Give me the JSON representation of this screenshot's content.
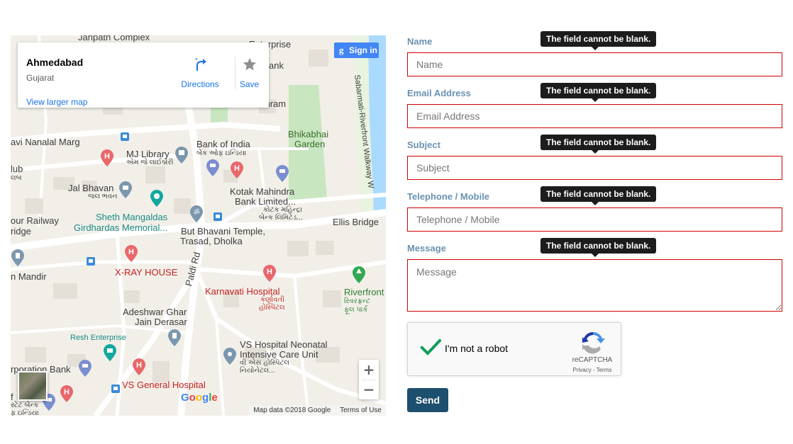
{
  "map": {
    "place_name": "Ahmedabad",
    "place_region": "Gujarat",
    "directions_label": "Directions",
    "save_label": "Save",
    "larger_map_label": "View larger map",
    "signin_label": "Sign in",
    "zoom_in_label": "+",
    "zoom_out_label": "−",
    "google_logo": [
      "G",
      "o",
      "o",
      "g",
      "l",
      "e"
    ],
    "google_colors": [
      "#4285f4",
      "#ea4335",
      "#fbbc05",
      "#4285f4",
      "#34a853",
      "#ea4335"
    ],
    "footer": {
      "map_data": "Map data ©2018 Google",
      "terms": "Terms of Use"
    },
    "labels": {
      "janpath": "Janpath Complex",
      "enterprise": "Enterprise",
      "bank_top": "ank",
      "ashram": "shram",
      "nanalal": "avi Nanalal Marg",
      "mj_library": "MJ Library",
      "mj_library_guj": "એમ જે લાઈબ્રેરી",
      "bank_of_india": "Bank of India",
      "bank_of_india_guj": "બેંક ઓફ ઇન્ડિયા",
      "bhikabhai": "Bhikabhai",
      "garden": "Garden",
      "riverfront_walkway": "Sabarmati-Riverfront Walkway W",
      "club": "lub",
      "club_guj": "લબ",
      "jal_bhavan": "Jal Bhavan",
      "jal_bhavan_guj": "જલ ભવન",
      "kotak_1": "Kotak Mahindra",
      "kotak_2": "Bank Limited...",
      "kotak_guj_1": "કોટક મહિન્દ્રા",
      "kotak_guj_2": "બેન્ક લિમિટેડ...",
      "railway_1": "our Railway",
      "railway_2": "ridge",
      "sheth_1": "Sheth Mangaldas",
      "sheth_2": "Girdhardas Memorial...",
      "ellis_bridge": "Ellis Bridge",
      "bhavani_1": "But Bhavani Temple,",
      "bhavani_2": "Trasad, Dholka",
      "paldi_rd": "Paldi Rd",
      "mandir": "n Mandir",
      "xray": "X-RAY HOUSE",
      "karnavati": "Karnavati Hospital",
      "karnavati_guj_1": "કર્ણાવતી",
      "karnavati_guj_2": "હોસ્પિટલ",
      "riverfront": "Riverfront",
      "riverfront_guj_1": "રિવરફ્રન્ટ",
      "riverfront_guj_2": "ફૂલ પાર્ક",
      "adeshwar_1": "Adeshwar Ghar",
      "adeshwar_2": "Jain Derasar",
      "resh": "Resh Enterprise",
      "vs_neo_1": "VS Hospital Neonatal",
      "vs_neo_2": "Intensive Care Unit",
      "vs_neo_guj_1": "વી એસ હોસ્પિટલ",
      "vs_neo_guj_2": "નિયોનેટલ...",
      "corp_bank": "rporation Bank",
      "vs_general": "VS General Hospital",
      "state_bank_1": "f",
      "state_bank_guj_1": "સ્ટેટ બેન્ક",
      "state_bank_guj_2": "ફ ઇન્ડિયા"
    }
  },
  "form": {
    "error_message": "The field cannot be blank.",
    "fields": [
      {
        "label": "Name",
        "placeholder": "Name",
        "value": ""
      },
      {
        "label": "Email Address",
        "placeholder": "Email Address",
        "value": ""
      },
      {
        "label": "Subject",
        "placeholder": "Subject",
        "value": ""
      },
      {
        "label": "Telephone / Mobile",
        "placeholder": "Telephone / Mobile",
        "value": ""
      },
      {
        "label": "Message",
        "placeholder": "Message",
        "value": ""
      }
    ],
    "recaptcha": {
      "label": "I'm not a robot",
      "brand": "reCAPTCHA",
      "links": "Privacy - Terms",
      "checked": true
    },
    "send_label": "Send"
  },
  "colors": {
    "label": "#6a93b2",
    "error_border": "#d20000",
    "tooltip_bg": "#1c1c1c",
    "send_bg": "#1d4f6e",
    "check_green": "#0f9d58",
    "map_link": "#1a73e8"
  }
}
